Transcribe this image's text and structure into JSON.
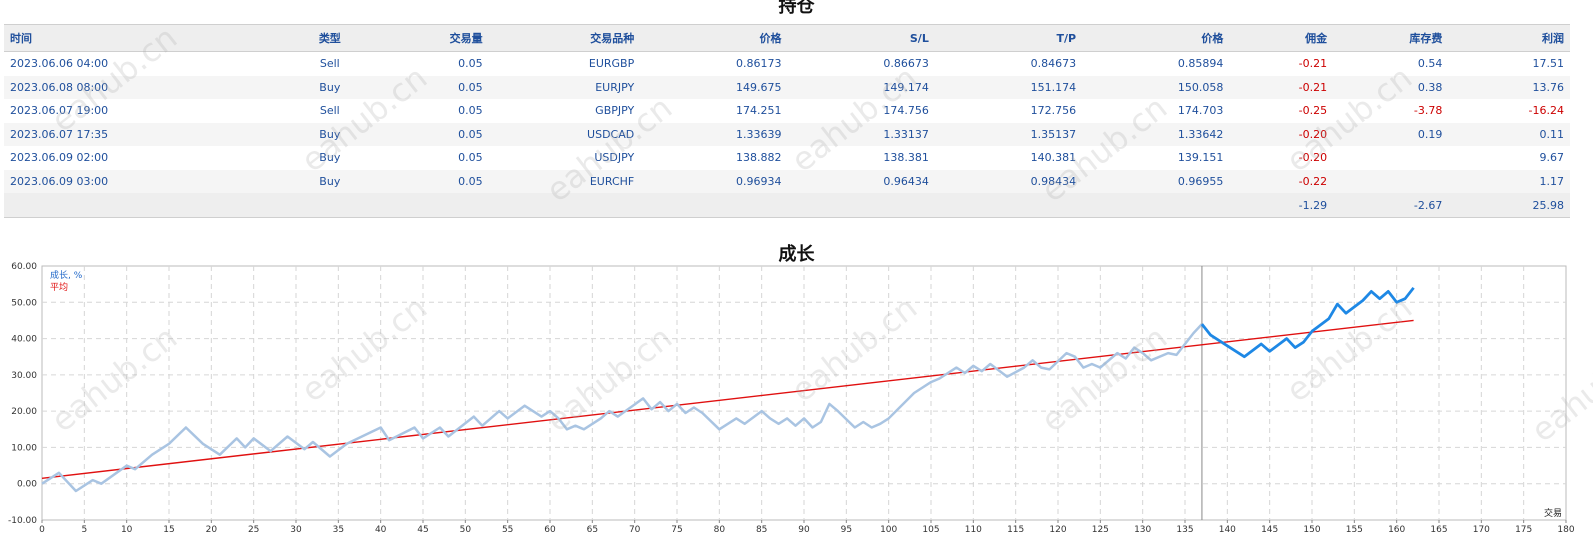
{
  "positions": {
    "title": "持仓",
    "columns": [
      "时间",
      "类型",
      "交易量",
      "交易品种",
      "价格",
      "S/L",
      "T/P",
      "价格",
      "佣金",
      "库存费",
      "利润"
    ],
    "rows": [
      [
        "2023.06.06 04:00",
        "Sell",
        "0.05",
        "EURGBP",
        "0.86173",
        "0.86673",
        "0.84673",
        "0.85894",
        "-0.21",
        "0.54",
        "17.51"
      ],
      [
        "2023.06.08 08:00",
        "Buy",
        "0.05",
        "EURJPY",
        "149.675",
        "149.174",
        "151.174",
        "150.058",
        "-0.21",
        "0.38",
        "13.76"
      ],
      [
        "2023.06.07 19:00",
        "Sell",
        "0.05",
        "GBPJPY",
        "174.251",
        "174.756",
        "172.756",
        "174.703",
        "-0.25",
        "-3.78",
        "-16.24"
      ],
      [
        "2023.06.07 17:35",
        "Buy",
        "0.05",
        "USDCAD",
        "1.33639",
        "1.33137",
        "1.35137",
        "1.33642",
        "-0.20",
        "0.19",
        "0.11"
      ],
      [
        "2023.06.09 02:00",
        "Buy",
        "0.05",
        "USDJPY",
        "138.882",
        "138.381",
        "140.381",
        "139.151",
        "-0.20",
        "",
        "9.67"
      ],
      [
        "2023.06.09 03:00",
        "Buy",
        "0.05",
        "EURCHF",
        "0.96934",
        "0.96434",
        "0.98434",
        "0.96955",
        "-0.22",
        "",
        "1.17"
      ]
    ],
    "totals": {
      "commission": "-1.29",
      "swap": "-2.67",
      "profit": "25.98"
    }
  },
  "watermark": "eahub.cn",
  "chart_data": {
    "type": "line",
    "title": "成长",
    "xlabel": "交易",
    "ylim": [
      -10,
      60
    ],
    "yticks": [
      "60.00",
      "50.00",
      "40.00",
      "30.00",
      "20.00",
      "10.00",
      "0.00",
      "-10.00"
    ],
    "xlim": [
      0,
      180
    ],
    "xticks": [
      0,
      5,
      10,
      15,
      20,
      25,
      30,
      35,
      40,
      45,
      50,
      55,
      60,
      65,
      70,
      75,
      80,
      85,
      90,
      95,
      100,
      105,
      110,
      115,
      120,
      125,
      130,
      135,
      140,
      145,
      150,
      155,
      160,
      165,
      170,
      175,
      180
    ],
    "grid": true,
    "legend_position": "top-left",
    "colors": {
      "history": "#a9c4e2",
      "forward": "#1e88e5",
      "trend": "#e01010",
      "divider": "#888888"
    },
    "divider_x": 137,
    "series": [
      {
        "name": "成长, %",
        "role": "growth",
        "points": [
          [
            0,
            0
          ],
          [
            2,
            3
          ],
          [
            4,
            -2
          ],
          [
            6,
            1
          ],
          [
            7,
            0
          ],
          [
            10,
            5
          ],
          [
            11,
            4
          ],
          [
            13,
            8
          ],
          [
            15,
            11
          ],
          [
            17,
            15.5
          ],
          [
            19,
            11
          ],
          [
            21,
            8
          ],
          [
            23,
            12.5
          ],
          [
            24,
            10
          ],
          [
            25,
            12.5
          ],
          [
            27,
            9
          ],
          [
            29,
            13
          ],
          [
            31,
            9.5
          ],
          [
            32,
            11.5
          ],
          [
            34,
            7.5
          ],
          [
            36,
            11
          ],
          [
            40,
            15.5
          ],
          [
            41,
            12
          ],
          [
            44,
            15.5
          ],
          [
            45,
            12.5
          ],
          [
            47,
            15.5
          ],
          [
            48,
            13
          ],
          [
            51,
            18.5
          ],
          [
            52,
            16
          ],
          [
            54,
            20
          ],
          [
            55,
            18
          ],
          [
            57,
            21.5
          ],
          [
            59,
            18.5
          ],
          [
            60,
            20
          ],
          [
            61,
            18
          ],
          [
            62,
            15
          ],
          [
            63,
            16
          ],
          [
            64,
            15
          ],
          [
            66,
            18
          ],
          [
            67,
            20
          ],
          [
            68,
            18.5
          ],
          [
            71,
            23.5
          ],
          [
            72,
            20.5
          ],
          [
            73,
            22.5
          ],
          [
            74,
            20
          ],
          [
            75,
            22
          ],
          [
            76,
            19.5
          ],
          [
            77,
            21
          ],
          [
            78,
            19.5
          ],
          [
            80,
            15
          ],
          [
            82,
            18
          ],
          [
            83,
            16.5
          ],
          [
            85,
            20
          ],
          [
            86,
            18
          ],
          [
            87,
            16.5
          ],
          [
            88,
            18
          ],
          [
            89,
            16
          ],
          [
            90,
            18
          ],
          [
            91,
            15.5
          ],
          [
            92,
            17
          ],
          [
            93,
            22
          ],
          [
            94,
            20
          ],
          [
            96,
            15.5
          ],
          [
            97,
            17
          ],
          [
            98,
            15.5
          ],
          [
            99,
            16.5
          ],
          [
            100,
            18
          ],
          [
            103,
            25
          ],
          [
            105,
            28
          ],
          [
            106,
            29
          ],
          [
            108,
            32
          ],
          [
            109,
            30.5
          ],
          [
            110,
            32.5
          ],
          [
            111,
            31
          ],
          [
            112,
            33
          ],
          [
            114,
            29.5
          ],
          [
            116,
            32
          ],
          [
            117,
            34
          ],
          [
            118,
            32
          ],
          [
            119,
            31.5
          ],
          [
            121,
            36
          ],
          [
            122,
            35
          ],
          [
            123,
            32
          ],
          [
            124,
            33
          ],
          [
            125,
            32
          ],
          [
            126,
            34
          ],
          [
            127,
            36
          ],
          [
            128,
            34.5
          ],
          [
            129,
            37.5
          ],
          [
            130,
            36
          ],
          [
            131,
            34
          ],
          [
            133,
            36
          ],
          [
            134,
            35.5
          ],
          [
            135,
            38.5
          ],
          [
            136,
            41.5
          ],
          [
            137,
            44
          ],
          [
            138,
            41
          ],
          [
            140,
            38
          ],
          [
            142,
            35
          ],
          [
            144,
            38.5
          ],
          [
            145,
            36.5
          ],
          [
            147,
            40
          ],
          [
            148,
            37.5
          ],
          [
            149,
            39
          ],
          [
            150,
            42
          ],
          [
            152,
            45.5
          ],
          [
            153,
            49.5
          ],
          [
            154,
            47
          ],
          [
            156,
            50.5
          ],
          [
            157,
            53
          ],
          [
            158,
            51
          ],
          [
            159,
            53
          ],
          [
            160,
            50
          ],
          [
            161,
            51
          ],
          [
            162,
            54
          ]
        ]
      },
      {
        "name": "平均",
        "role": "trend",
        "points": [
          [
            0,
            1.5
          ],
          [
            162,
            45
          ]
        ]
      }
    ]
  }
}
